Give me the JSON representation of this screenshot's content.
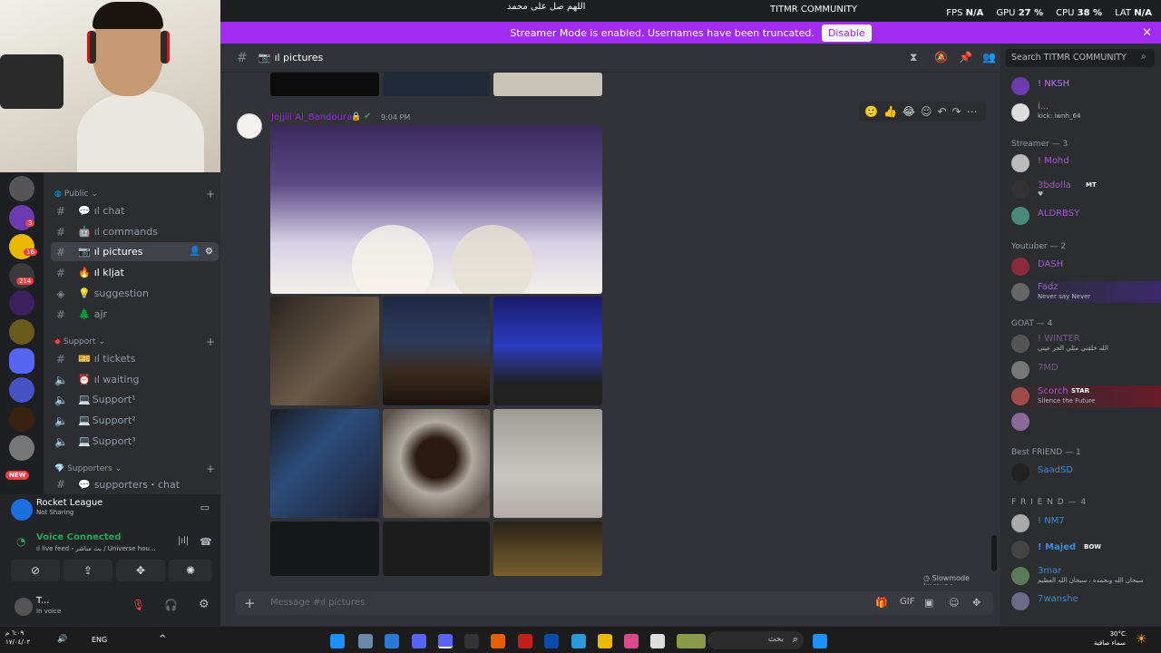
{
  "window": {
    "title": "TITMR COMMUNITY",
    "fps_label": "FPS",
    "fps": "N/A",
    "gpu_label": "GPU",
    "gpu": "27 %",
    "cpu_label": "CPU",
    "cpu": "38 %",
    "lat_label": "LAT",
    "lat": "N/A",
    "overlay_text": "اللهم صل على محمد"
  },
  "banner": {
    "text": "Streamer Mode is enabled. Usernames have been truncated.",
    "button": "Disable"
  },
  "channel_header": {
    "name": "ıl pictures",
    "search_placeholder": "Search TITMR COMMUNITY"
  },
  "server_badges": [
    "3",
    "16",
    "214",
    "NEW"
  ],
  "categories": [
    {
      "label": "Public"
    },
    {
      "label": "Support"
    },
    {
      "label": "Supporters"
    }
  ],
  "channels": [
    {
      "label": "ıl chat"
    },
    {
      "label": "ıl commands"
    },
    {
      "label": "ıl pictures"
    },
    {
      "label": "ıl kljat"
    },
    {
      "label": "suggestion"
    },
    {
      "label": "ajr"
    },
    {
      "label": "ıl tickets"
    },
    {
      "label": "ıl waiting"
    },
    {
      "label": "Support¹"
    },
    {
      "label": "Support²"
    },
    {
      "label": "Support³"
    },
    {
      "label": "supporters・chat"
    }
  ],
  "activity": {
    "game": "Rocket League",
    "status": "Not Sharing"
  },
  "voice": {
    "status": "Voice Connected",
    "detail": "ıl live feed・بث مباشر / Universe hou..."
  },
  "user": {
    "name": "T...",
    "status": "In voice"
  },
  "message": {
    "author": "Jojjiii Al_Bandoura",
    "time": "9:04 PM"
  },
  "composer": {
    "placeholder": "Message #ıl pictures",
    "slowmode": "Slowmode Immune"
  },
  "members": {
    "top": [
      {
        "name": "! NKSH"
      },
      {
        "name": "i...",
        "sub": "kick: iwnh_64"
      }
    ],
    "groups": [
      {
        "title": "Streamer — 3",
        "items": [
          {
            "name": "! Mohd"
          },
          {
            "name": "3bdolla",
            "tag": "MT"
          },
          {
            "name": "ALDRBSY"
          }
        ]
      },
      {
        "title": "Youtuber — 2",
        "items": [
          {
            "name": "DASH"
          },
          {
            "name": "Fadz",
            "sub": "Never say Never"
          }
        ]
      },
      {
        "title": "GOAT — 4",
        "items": [
          {
            "name": "! WINTER",
            "sub": "الله خلقني مثلي الحر عيني"
          },
          {
            "name": "7MD"
          },
          {
            "name": "Scorch",
            "tag": "STAR",
            "sub": "Silence the Future"
          },
          {
            "name": ""
          }
        ]
      },
      {
        "title": "Best FRIEND — 1",
        "items": [
          {
            "name": "SaadSD"
          }
        ]
      },
      {
        "title": "F R I E N D — 4",
        "items": [
          {
            "name": "! NM7"
          },
          {
            "name": "! Majed",
            "tag": "BOW"
          },
          {
            "name": "3mar",
            "sub": "سبحان الله وبحمده ، سبحان الله العظيم"
          },
          {
            "name": "7wanshe"
          }
        ]
      }
    ]
  },
  "taskbar": {
    "date_line1": "٦:٠٩ م",
    "date_line2": "١٧/٠٤/٠٢",
    "lang": "ENG",
    "search": "بحث",
    "weather_temp": "30°C",
    "weather_text": "سماء صافية"
  },
  "colors": {
    "accent": "#a12cf0",
    "blurple": "#5865f2",
    "green": "#23a55a"
  }
}
